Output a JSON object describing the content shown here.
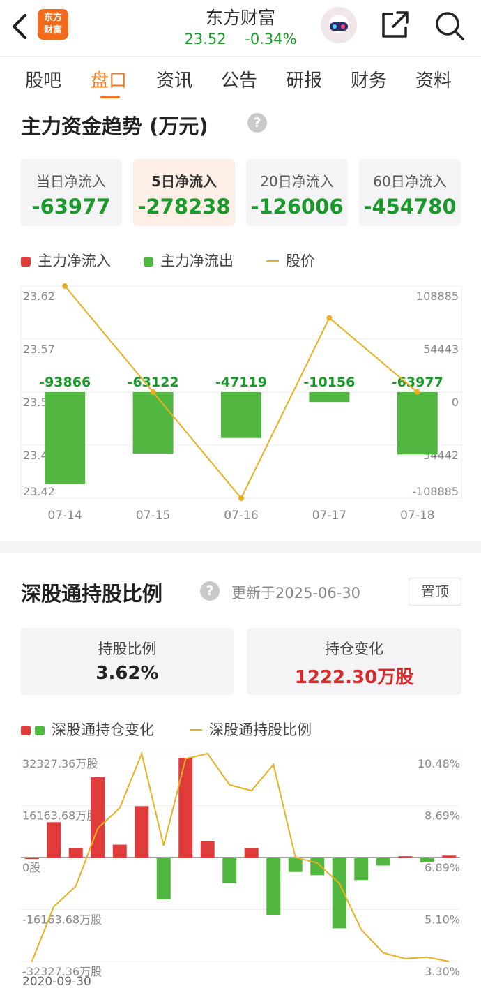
{
  "header": {
    "logo_line1": "东方",
    "logo_line2": "财富",
    "title": "东方财富",
    "price": "23.52",
    "change": "-0.34%"
  },
  "tabs": [
    "股吧",
    "盘口",
    "资讯",
    "公告",
    "研报",
    "财务",
    "资料"
  ],
  "active_tab": "盘口",
  "fund_flow": {
    "title": "主力资金趋势 (万元)",
    "help": "?",
    "cards": [
      {
        "label": "当日净流入",
        "value": "-63977"
      },
      {
        "label": "5日净流入",
        "value": "-278238"
      },
      {
        "label": "20日净流入",
        "value": "-126006"
      },
      {
        "label": "60日净流入",
        "value": "-454780"
      }
    ],
    "active_card": "5日净流入",
    "legend": {
      "inflow": "主力净流入",
      "outflow": "主力净流出",
      "price": "股价"
    }
  },
  "holding": {
    "title": "深股通持股比例",
    "help": "?",
    "updated": "更新于2025-06-30",
    "pin_label": "置顶",
    "ratio_label": "持股比例",
    "ratio_value": "3.62%",
    "change_label": "持仓变化",
    "change_value": "1222.30万股",
    "legend": {
      "change": "深股通持仓变化",
      "ratio": "深股通持股比例"
    }
  },
  "colors": {
    "red": "#e03c3c",
    "green": "#52b740",
    "orange": "#f0781e",
    "price_line": "#e8b020",
    "value_green": "#1a9a2a"
  },
  "chart_data": [
    {
      "type": "bar",
      "categories": [
        "07-14",
        "07-15",
        "07-16",
        "07-17",
        "07-18"
      ],
      "series": [
        {
          "name": "主力净流入",
          "values": [
            0,
            0,
            0,
            0,
            0
          ]
        },
        {
          "name": "主力净流出",
          "values": [
            -93866,
            -63122,
            -47119,
            -10156,
            -63977
          ]
        },
        {
          "name": "股价",
          "type": "line",
          "values": [
            23.62,
            23.52,
            23.42,
            23.59,
            23.52
          ]
        }
      ],
      "bar_labels": [
        "-93866",
        "-63122",
        "-47119",
        "-10156",
        "-63977"
      ],
      "left_axis_ticks": [
        "23.62",
        "23.57",
        "23.52",
        "23.47",
        "23.42"
      ],
      "right_axis_ticks": [
        "108885",
        "54443",
        "0",
        "54442",
        "-108885"
      ],
      "ylim_left": [
        23.42,
        23.62
      ],
      "ylim_right": [
        -108885,
        108885
      ]
    },
    {
      "type": "bar",
      "series": [
        {
          "name": "深股通持仓变化",
          "values": [
            0,
            11000,
            3000,
            25000,
            4000,
            16000,
            -13000,
            31000,
            5000,
            -8000,
            3000,
            -18000,
            -4500,
            -5500,
            -22000,
            -7000,
            -2500,
            400,
            -1500,
            600
          ]
        },
        {
          "name": "深股通持股比例",
          "type": "line",
          "values": [
            3.3,
            5.2,
            5.9,
            7.9,
            8.6,
            10.48,
            7.3,
            10.3,
            10.48,
            9.4,
            9.2,
            10.1,
            6.9,
            6.7,
            6.0,
            4.4,
            3.6,
            3.4,
            3.45,
            3.3
          ]
        }
      ],
      "first_category": "2020-09-30",
      "left_axis_ticks": [
        "32327.36万股",
        "16163.68万股",
        "0股",
        "-16163.68万股",
        "-32327.36万股"
      ],
      "right_axis_ticks": [
        "10.48%",
        "8.69%",
        "6.89%",
        "5.10%",
        "3.30%"
      ],
      "ylim_left": [
        -32327.36,
        32327.36
      ],
      "ylim_right": [
        3.3,
        10.48
      ]
    }
  ]
}
